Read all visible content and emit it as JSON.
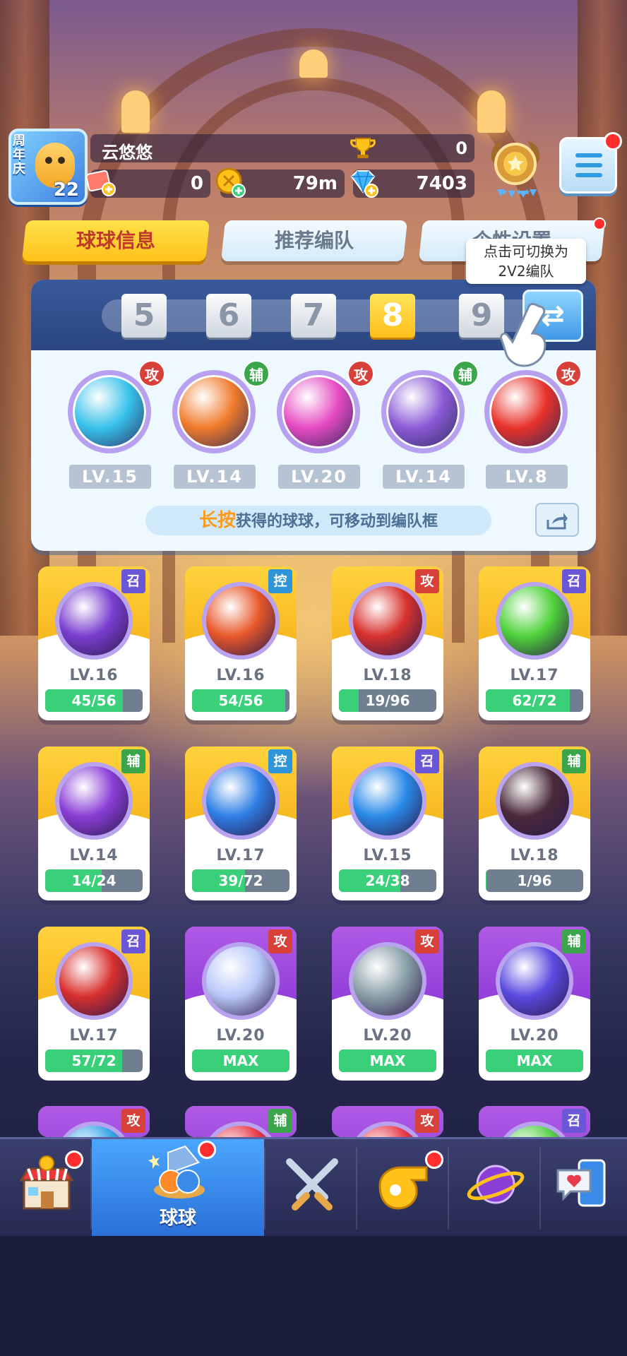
{
  "player": {
    "anniversary": "周年庆",
    "avatar_level": "22",
    "name": "云悠悠",
    "trophies": "0"
  },
  "resources": {
    "tickets": "0",
    "coins": "79m",
    "gems": "7403"
  },
  "tabs": [
    {
      "label": "球球信息",
      "active": true
    },
    {
      "label": "推荐编队",
      "active": false
    },
    {
      "label": "个性设置",
      "active": false
    }
  ],
  "tooltip": {
    "line1": "点击可切换为",
    "line2": "2V2编队"
  },
  "formation": {
    "slots": [
      "5",
      "6",
      "7",
      "8",
      "9"
    ],
    "active_slot": "8",
    "balls": [
      {
        "role": "攻",
        "level": "LV.15",
        "color": "#37c1ea"
      },
      {
        "role": "辅",
        "level": "LV.14",
        "color": "#f07a2a"
      },
      {
        "role": "攻",
        "level": "LV.20",
        "color": "#e64ac2"
      },
      {
        "role": "辅",
        "level": "LV.14",
        "color": "#8b5ad6"
      },
      {
        "role": "攻",
        "level": "LV.8",
        "color": "#e8322a"
      }
    ],
    "hint_key": "长按",
    "hint_rest": "获得的球球，可移动到编队框"
  },
  "cards": [
    {
      "type": "召",
      "type_class": "sum",
      "level": "LV.16",
      "progress": "45/56",
      "fill": 0.8,
      "bg": "gold",
      "color": "#7a3ed0"
    },
    {
      "type": "控",
      "type_class": "ctl",
      "level": "LV.16",
      "progress": "54/56",
      "fill": 0.96,
      "bg": "gold",
      "color": "#e8582a"
    },
    {
      "type": "攻",
      "type_class": "atk",
      "level": "LV.18",
      "progress": "19/96",
      "fill": 0.2,
      "bg": "gold",
      "color": "#d8322e"
    },
    {
      "type": "召",
      "type_class": "sum",
      "level": "LV.17",
      "progress": "62/72",
      "fill": 0.86,
      "bg": "gold",
      "color": "#4fd23a"
    },
    {
      "type": "辅",
      "type_class": "sup",
      "level": "LV.14",
      "progress": "14/24",
      "fill": 0.58,
      "bg": "gold",
      "color": "#8a3ed6"
    },
    {
      "type": "控",
      "type_class": "ctl",
      "level": "LV.17",
      "progress": "39/72",
      "fill": 0.54,
      "bg": "gold",
      "color": "#2f7fe6"
    },
    {
      "type": "召",
      "type_class": "sum",
      "level": "LV.15",
      "progress": "24/38",
      "fill": 0.63,
      "bg": "gold",
      "color": "#2a8ae8"
    },
    {
      "type": "辅",
      "type_class": "sup",
      "level": "LV.18",
      "progress": "1/96",
      "fill": 0.01,
      "bg": "gold",
      "color": "#4a2a3a"
    },
    {
      "type": "召",
      "type_class": "sum",
      "level": "LV.17",
      "progress": "57/72",
      "fill": 0.79,
      "bg": "gold",
      "color": "#d8302e"
    },
    {
      "type": "攻",
      "type_class": "atk",
      "level": "LV.20",
      "progress": "MAX",
      "fill": 1.0,
      "bg": "purple",
      "color": "#b8c8f8"
    },
    {
      "type": "攻",
      "type_class": "atk",
      "level": "LV.20",
      "progress": "MAX",
      "fill": 1.0,
      "bg": "purple",
      "color": "#8aa0a8"
    },
    {
      "type": "辅",
      "type_class": "sup",
      "level": "LV.20",
      "progress": "MAX",
      "fill": 1.0,
      "bg": "purple",
      "color": "#5a4ae0"
    },
    {
      "type": "攻",
      "type_class": "atk",
      "level": "",
      "progress": "",
      "fill": 0,
      "bg": "purple",
      "color": "#3aa8e8"
    },
    {
      "type": "辅",
      "type_class": "sup",
      "level": "",
      "progress": "",
      "fill": 0,
      "bg": "purple",
      "color": "#e83a4a"
    },
    {
      "type": "攻",
      "type_class": "atk",
      "level": "",
      "progress": "",
      "fill": 0,
      "bg": "purple",
      "color": "#e83a4a"
    },
    {
      "type": "召",
      "type_class": "sum",
      "level": "",
      "progress": "",
      "fill": 0,
      "bg": "purple",
      "color": "#5ad24a"
    }
  ],
  "nav": [
    {
      "icon": "shop-icon",
      "label": "",
      "active": false,
      "badge": true
    },
    {
      "icon": "balls-icon",
      "label": "球球",
      "active": true,
      "badge": true
    },
    {
      "icon": "battle-icon",
      "label": "",
      "active": false,
      "badge": false
    },
    {
      "icon": "whistle-icon",
      "label": "",
      "active": false,
      "badge": true
    },
    {
      "icon": "planet-icon",
      "label": "",
      "active": false,
      "badge": false
    },
    {
      "icon": "social-icon",
      "label": "",
      "active": false,
      "badge": false
    }
  ]
}
